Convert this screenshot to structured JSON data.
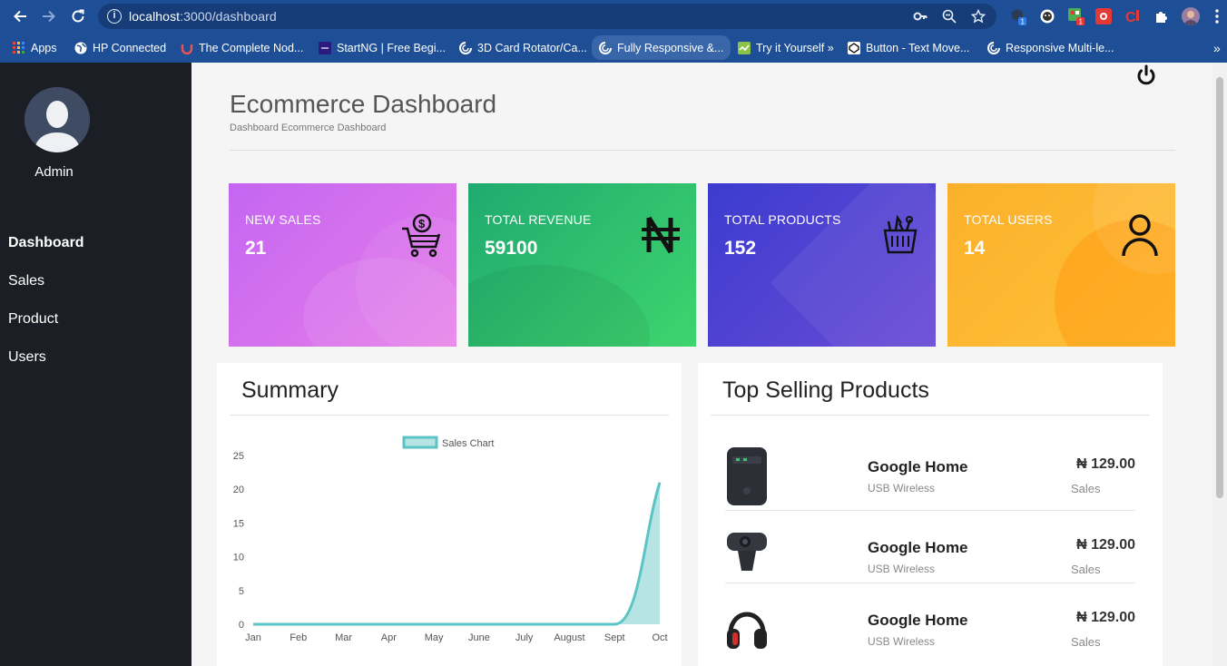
{
  "browser": {
    "url_host": "localhost",
    "url_path": ":3000/dashboard",
    "bookmarks": [
      {
        "label": "Apps",
        "icon": "apps-grid-icon"
      },
      {
        "label": "HP Connected",
        "icon": "globe-icon"
      },
      {
        "label": "The Complete Nod...",
        "icon": "udemy-icon"
      },
      {
        "label": "StartNG | Free Begi...",
        "icon": "startng-icon"
      },
      {
        "label": "3D Card Rotator/Ca...",
        "icon": "codepen-icon"
      },
      {
        "label": "Fully Responsive &...",
        "icon": "codepen-icon"
      },
      {
        "label": "Try it Yourself »",
        "icon": "w3schools-icon"
      },
      {
        "label": "Button - Text Move...",
        "icon": "codepen-box-icon"
      },
      {
        "label": "Responsive Multi-le...",
        "icon": "codepen-icon"
      }
    ],
    "overflow": "»",
    "ext_badges": [
      "1",
      "1"
    ]
  },
  "sidebar": {
    "user": "Admin",
    "items": [
      {
        "label": "Dashboard",
        "active": true
      },
      {
        "label": "Sales",
        "active": false
      },
      {
        "label": "Product",
        "active": false
      },
      {
        "label": "Users",
        "active": false
      }
    ]
  },
  "header": {
    "title": "Ecommerce Dashboard",
    "breadcrumb": "Dashboard Ecommerce Dashboard"
  },
  "cards": [
    {
      "label": "NEW SALES",
      "value": "21",
      "icon": "money-cart-icon"
    },
    {
      "label": "TOTAL REVENUE",
      "value": "59100",
      "icon": "naira-icon"
    },
    {
      "label": "TOTAL PRODUCTS",
      "value": "152",
      "icon": "basket-icon"
    },
    {
      "label": "TOTAL USERS",
      "value": "14",
      "icon": "user-icon"
    }
  ],
  "summary": {
    "title": "Summary"
  },
  "top_products": {
    "title": "Top Selling Products",
    "items": [
      {
        "name": "Google Home",
        "sub": "USB Wireless",
        "price": "₦ 129.00",
        "status": "Sales",
        "image": "router-image"
      },
      {
        "name": "Google Home",
        "sub": "USB Wireless",
        "price": "₦ 129.00",
        "status": "Sales",
        "image": "webcam-image"
      },
      {
        "name": "Google Home",
        "sub": "USB Wireless",
        "price": "₦ 129.00",
        "status": "Sales",
        "image": "headphones-image"
      }
    ]
  },
  "colors": {
    "sidebar": "#1b1e25",
    "card_sales": "#d573ee",
    "card_revenue": "#2cc06f",
    "card_products": "#4a40d2",
    "card_users": "#fcb42c",
    "chart_line": "#5cc4c4",
    "chart_fill": "#b6e3e3"
  },
  "chart_data": {
    "type": "area",
    "categories": [
      "Jan",
      "Feb",
      "Mar",
      "Apr",
      "May",
      "June",
      "July",
      "August",
      "Sept",
      "Oct"
    ],
    "series": [
      {
        "name": "Sales Chart",
        "values": [
          0,
          0,
          0,
          0,
          0,
          0,
          0,
          0,
          0,
          21
        ]
      }
    ],
    "ylim": [
      0,
      25
    ],
    "yticks": [
      0,
      5,
      10,
      15,
      20,
      25
    ],
    "legend": "top-center",
    "grid": false
  }
}
